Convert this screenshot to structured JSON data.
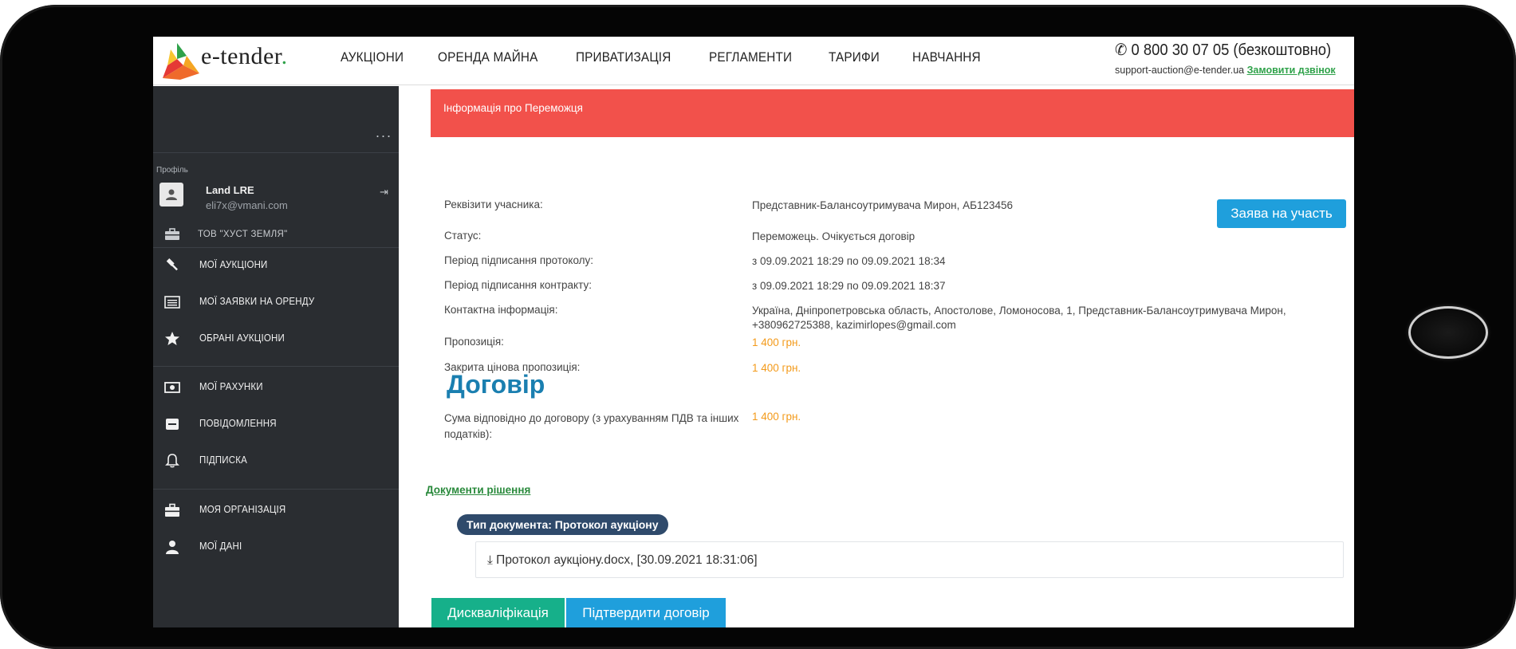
{
  "header": {
    "brand": "e-tender",
    "nav": [
      "АУКЦІОНИ",
      "ОРЕНДА МАЙНА",
      "ПРИВАТИЗАЦІЯ",
      "РЕГЛАМЕНТИ",
      "ТАРИФИ",
      "НАВЧАННЯ"
    ],
    "phone": "0 800 30 07 05 (безкоштовно)",
    "support_email": "support-auction@e-tender.ua",
    "callback_link": "Замовити дзвінок"
  },
  "sidebar": {
    "more_dots": "...",
    "profile_label": "Профіль",
    "user_name": "Land LRE",
    "user_email": "eli7x@vmani.com",
    "organization": "ТОВ \"ХУСТ ЗЕМЛЯ\"",
    "items": [
      {
        "label": "МОЇ АУКЦІОНИ",
        "icon": "gavel-icon"
      },
      {
        "label": "МОЇ ЗАЯВКИ НА ОРЕНДУ",
        "icon": "list-icon"
      },
      {
        "label": "ОБРАНІ АУКЦІОНИ",
        "icon": "star-icon"
      },
      {
        "label": "МОЇ РАХУНКИ",
        "icon": "money-icon"
      },
      {
        "label": "ПОВІДОМЛЕННЯ",
        "icon": "envelope-icon"
      },
      {
        "label": "ПІДПИСКА",
        "icon": "bell-icon"
      },
      {
        "label": "МОЯ ОРГАНІЗАЦІЯ",
        "icon": "briefcase-icon"
      },
      {
        "label": "МОЇ ДАНІ",
        "icon": "user-icon"
      }
    ]
  },
  "main": {
    "winner_info_title": "Інформація про Переможця",
    "apply_button": "Заява на участь",
    "rows": [
      {
        "label": "Реквізити учасника:",
        "value": "Представник-Балансоутримувача Мирон, АБ123456"
      },
      {
        "label": "Статус:",
        "value": "Переможець. Очікується договір"
      },
      {
        "label": "Період підписання протоколу:",
        "value": "з 09.09.2021 18:29 по 09.09.2021 18:34"
      },
      {
        "label": "Період підписання контракту:",
        "value": "з 09.09.2021 18:29 по 09.09.2021 18:37"
      },
      {
        "label": "Контактна інформація:",
        "value": "Україна, Дніпропетровська область, Апостолове, Ломоносова, 1, Представник-Балансоутримувача Мирон, +380962725388, kazimirlopes@gmail.com"
      },
      {
        "label": "Пропозиція:",
        "value": "1 400 грн."
      },
      {
        "label": "Закрита цінова пропозиція:",
        "value": "1 400 грн."
      }
    ],
    "contract_title": "Договір",
    "contract_sum_label": "Сума відповідно до договору (з урахуванням ПДВ та інших податків):",
    "contract_sum_value": "1 400 грн.",
    "documents_link": "Документи рішення",
    "doc_type": "Тип документа: Протокол аукціону",
    "doc_file": "Протокол аукціону.docx, [30.09.2021 18:31:06]",
    "disqualify_button": "Дискваліфікація",
    "confirm_button": "Підтвердити договір"
  },
  "colors": {
    "winner_bar": "#f2514b",
    "primary_blue": "#1f9fdc",
    "green_button": "#16b08a",
    "amount_orange": "#f39a1a",
    "sidebar_bg": "#2a2d31"
  }
}
